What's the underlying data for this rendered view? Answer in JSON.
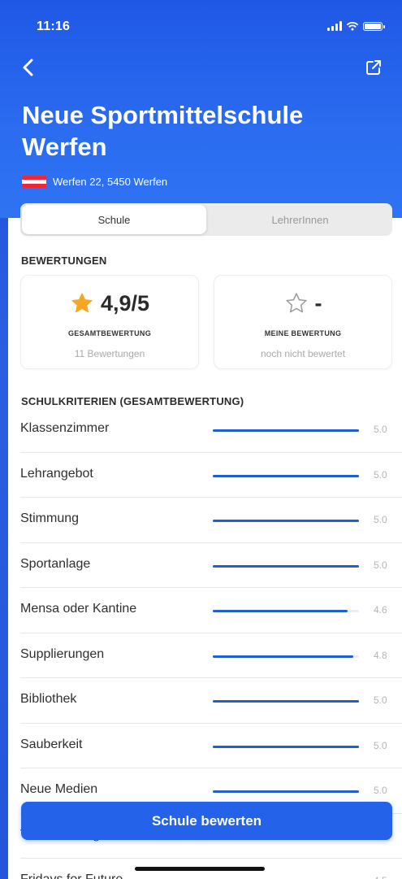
{
  "status_bar": {
    "time": "11:16"
  },
  "header": {
    "title": "Neue Sportmittelschule Werfen",
    "address": "Werfen 22, 5450 Werfen",
    "colors": {
      "header_blue": "#2b6cf0",
      "accent": "#2462ea"
    }
  },
  "tabs": [
    {
      "label": "Schule",
      "active": true
    },
    {
      "label": "LehrerInnen",
      "active": false
    }
  ],
  "ratings": {
    "section_title": "BEWERTUNGEN",
    "overall": {
      "value": "4,9/5",
      "label": "GESAMTBEWERTUNG",
      "sub": "11 Bewertungen"
    },
    "mine": {
      "value": "-",
      "label": "MEINE BEWERTUNG",
      "sub": "noch nicht bewertet"
    }
  },
  "criteria": {
    "section_title": "SCHULKRITERIEN (GESAMTBEWERTUNG)",
    "max": 5,
    "items": [
      {
        "label": "Klassenzimmer",
        "value": "5.0",
        "score": 5.0
      },
      {
        "label": "Lehrangebot",
        "value": "5.0",
        "score": 5.0
      },
      {
        "label": "Stimmung",
        "value": "5.0",
        "score": 5.0
      },
      {
        "label": "Sportanlage",
        "value": "5.0",
        "score": 5.0
      },
      {
        "label": "Mensa oder Kantine",
        "value": "4.6",
        "score": 4.6
      },
      {
        "label": "Supplierungen",
        "value": "4.8",
        "score": 4.8
      },
      {
        "label": "Bibliothek",
        "value": "5.0",
        "score": 5.0
      },
      {
        "label": "Sauberkeit",
        "value": "5.0",
        "score": 5.0
      },
      {
        "label": "Neue Medien",
        "value": "5.0",
        "score": 5.0
      },
      {
        "label": "Veranstaltungen",
        "value": "",
        "score": 5.0
      },
      {
        "label": "Fridays for Future",
        "value": "4.5",
        "score": 4.5
      }
    ]
  },
  "cta": {
    "label": "Schule bewerten"
  }
}
